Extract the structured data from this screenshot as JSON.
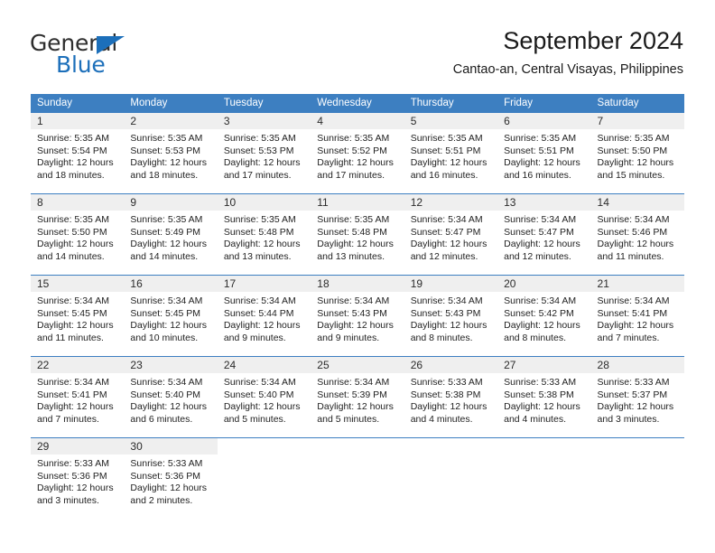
{
  "brand": {
    "name_part1": "General",
    "name_part2": "Blue",
    "accent_color": "#1c6fba",
    "triangle_icon": "triangle-logo-icon"
  },
  "header": {
    "title": "September 2024",
    "subtitle": "Cantao-an, Central Visayas, Philippines"
  },
  "weekdays": [
    "Sunday",
    "Monday",
    "Tuesday",
    "Wednesday",
    "Thursday",
    "Friday",
    "Saturday"
  ],
  "colors": {
    "header_band": "#3d7fc1",
    "day_number_band": "#efefef",
    "row_rule": "#3d7fc1",
    "text": "#222222"
  },
  "weeks": [
    [
      {
        "day": "1",
        "sunrise": "Sunrise: 5:35 AM",
        "sunset": "Sunset: 5:54 PM",
        "daylight": "Daylight: 12 hours and 18 minutes."
      },
      {
        "day": "2",
        "sunrise": "Sunrise: 5:35 AM",
        "sunset": "Sunset: 5:53 PM",
        "daylight": "Daylight: 12 hours and 18 minutes."
      },
      {
        "day": "3",
        "sunrise": "Sunrise: 5:35 AM",
        "sunset": "Sunset: 5:53 PM",
        "daylight": "Daylight: 12 hours and 17 minutes."
      },
      {
        "day": "4",
        "sunrise": "Sunrise: 5:35 AM",
        "sunset": "Sunset: 5:52 PM",
        "daylight": "Daylight: 12 hours and 17 minutes."
      },
      {
        "day": "5",
        "sunrise": "Sunrise: 5:35 AM",
        "sunset": "Sunset: 5:51 PM",
        "daylight": "Daylight: 12 hours and 16 minutes."
      },
      {
        "day": "6",
        "sunrise": "Sunrise: 5:35 AM",
        "sunset": "Sunset: 5:51 PM",
        "daylight": "Daylight: 12 hours and 16 minutes."
      },
      {
        "day": "7",
        "sunrise": "Sunrise: 5:35 AM",
        "sunset": "Sunset: 5:50 PM",
        "daylight": "Daylight: 12 hours and 15 minutes."
      }
    ],
    [
      {
        "day": "8",
        "sunrise": "Sunrise: 5:35 AM",
        "sunset": "Sunset: 5:50 PM",
        "daylight": "Daylight: 12 hours and 14 minutes."
      },
      {
        "day": "9",
        "sunrise": "Sunrise: 5:35 AM",
        "sunset": "Sunset: 5:49 PM",
        "daylight": "Daylight: 12 hours and 14 minutes."
      },
      {
        "day": "10",
        "sunrise": "Sunrise: 5:35 AM",
        "sunset": "Sunset: 5:48 PM",
        "daylight": "Daylight: 12 hours and 13 minutes."
      },
      {
        "day": "11",
        "sunrise": "Sunrise: 5:35 AM",
        "sunset": "Sunset: 5:48 PM",
        "daylight": "Daylight: 12 hours and 13 minutes."
      },
      {
        "day": "12",
        "sunrise": "Sunrise: 5:34 AM",
        "sunset": "Sunset: 5:47 PM",
        "daylight": "Daylight: 12 hours and 12 minutes."
      },
      {
        "day": "13",
        "sunrise": "Sunrise: 5:34 AM",
        "sunset": "Sunset: 5:47 PM",
        "daylight": "Daylight: 12 hours and 12 minutes."
      },
      {
        "day": "14",
        "sunrise": "Sunrise: 5:34 AM",
        "sunset": "Sunset: 5:46 PM",
        "daylight": "Daylight: 12 hours and 11 minutes."
      }
    ],
    [
      {
        "day": "15",
        "sunrise": "Sunrise: 5:34 AM",
        "sunset": "Sunset: 5:45 PM",
        "daylight": "Daylight: 12 hours and 11 minutes."
      },
      {
        "day": "16",
        "sunrise": "Sunrise: 5:34 AM",
        "sunset": "Sunset: 5:45 PM",
        "daylight": "Daylight: 12 hours and 10 minutes."
      },
      {
        "day": "17",
        "sunrise": "Sunrise: 5:34 AM",
        "sunset": "Sunset: 5:44 PM",
        "daylight": "Daylight: 12 hours and 9 minutes."
      },
      {
        "day": "18",
        "sunrise": "Sunrise: 5:34 AM",
        "sunset": "Sunset: 5:43 PM",
        "daylight": "Daylight: 12 hours and 9 minutes."
      },
      {
        "day": "19",
        "sunrise": "Sunrise: 5:34 AM",
        "sunset": "Sunset: 5:43 PM",
        "daylight": "Daylight: 12 hours and 8 minutes."
      },
      {
        "day": "20",
        "sunrise": "Sunrise: 5:34 AM",
        "sunset": "Sunset: 5:42 PM",
        "daylight": "Daylight: 12 hours and 8 minutes."
      },
      {
        "day": "21",
        "sunrise": "Sunrise: 5:34 AM",
        "sunset": "Sunset: 5:41 PM",
        "daylight": "Daylight: 12 hours and 7 minutes."
      }
    ],
    [
      {
        "day": "22",
        "sunrise": "Sunrise: 5:34 AM",
        "sunset": "Sunset: 5:41 PM",
        "daylight": "Daylight: 12 hours and 7 minutes."
      },
      {
        "day": "23",
        "sunrise": "Sunrise: 5:34 AM",
        "sunset": "Sunset: 5:40 PM",
        "daylight": "Daylight: 12 hours and 6 minutes."
      },
      {
        "day": "24",
        "sunrise": "Sunrise: 5:34 AM",
        "sunset": "Sunset: 5:40 PM",
        "daylight": "Daylight: 12 hours and 5 minutes."
      },
      {
        "day": "25",
        "sunrise": "Sunrise: 5:34 AM",
        "sunset": "Sunset: 5:39 PM",
        "daylight": "Daylight: 12 hours and 5 minutes."
      },
      {
        "day": "26",
        "sunrise": "Sunrise: 5:33 AM",
        "sunset": "Sunset: 5:38 PM",
        "daylight": "Daylight: 12 hours and 4 minutes."
      },
      {
        "day": "27",
        "sunrise": "Sunrise: 5:33 AM",
        "sunset": "Sunset: 5:38 PM",
        "daylight": "Daylight: 12 hours and 4 minutes."
      },
      {
        "day": "28",
        "sunrise": "Sunrise: 5:33 AM",
        "sunset": "Sunset: 5:37 PM",
        "daylight": "Daylight: 12 hours and 3 minutes."
      }
    ],
    [
      {
        "day": "29",
        "sunrise": "Sunrise: 5:33 AM",
        "sunset": "Sunset: 5:36 PM",
        "daylight": "Daylight: 12 hours and 3 minutes."
      },
      {
        "day": "30",
        "sunrise": "Sunrise: 5:33 AM",
        "sunset": "Sunset: 5:36 PM",
        "daylight": "Daylight: 12 hours and 2 minutes."
      },
      {
        "day": "",
        "sunrise": "",
        "sunset": "",
        "daylight": ""
      },
      {
        "day": "",
        "sunrise": "",
        "sunset": "",
        "daylight": ""
      },
      {
        "day": "",
        "sunrise": "",
        "sunset": "",
        "daylight": ""
      },
      {
        "day": "",
        "sunrise": "",
        "sunset": "",
        "daylight": ""
      },
      {
        "day": "",
        "sunrise": "",
        "sunset": "",
        "daylight": ""
      }
    ]
  ]
}
